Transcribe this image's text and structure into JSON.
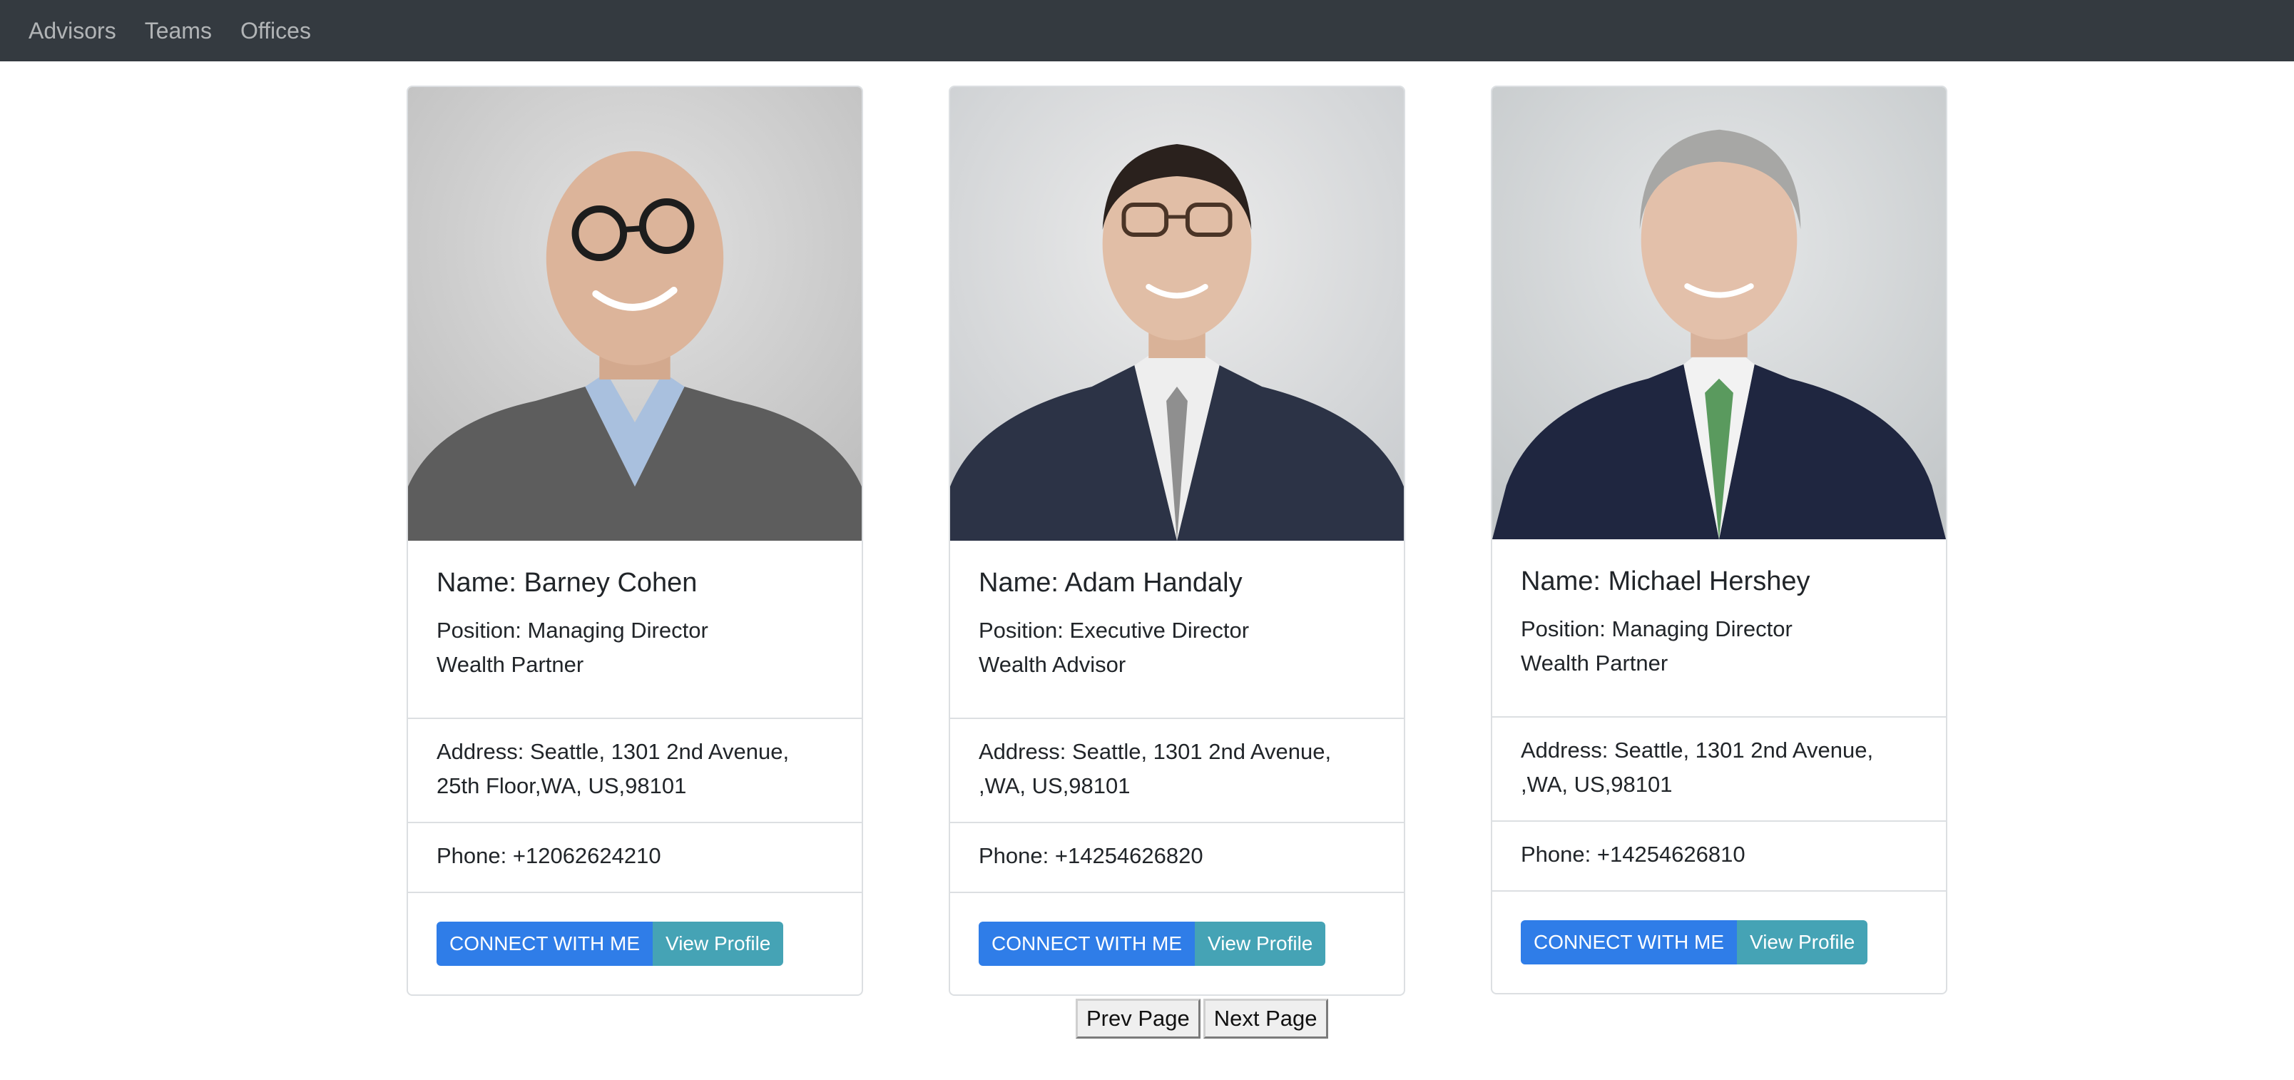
{
  "nav": {
    "items": [
      "Advisors",
      "Teams",
      "Offices"
    ]
  },
  "advisors": [
    {
      "name": "Name: Barney Cohen",
      "position_line1": "Position: Managing Director",
      "position_line2": "Wealth Partner",
      "address_line1": "Address: Seattle, 1301 2nd Avenue,",
      "address_line2": "25th Floor,WA, US,98101",
      "phone": "Phone: +12062624210",
      "connect_label": "CONNECT WITH ME",
      "profile_label": "View Profile"
    },
    {
      "name": "Name: Adam Handaly",
      "position_line1": "Position: Executive Director",
      "position_line2": "Wealth Advisor",
      "address_line1": "Address: Seattle, 1301 2nd Avenue,",
      "address_line2": ",WA, US,98101",
      "phone": "Phone: +14254626820",
      "connect_label": "CONNECT WITH ME",
      "profile_label": "View Profile"
    },
    {
      "name": "Name: Michael Hershey",
      "position_line1": "Position: Managing Director",
      "position_line2": "Wealth Partner",
      "address_line1": "Address: Seattle, 1301 2nd Avenue,",
      "address_line2": ",WA, US,98101",
      "phone": "Phone: +14254626810",
      "connect_label": "CONNECT WITH ME",
      "profile_label": "View Profile"
    }
  ],
  "pager": {
    "prev_label": "Prev Page",
    "next_label": "Next Page"
  },
  "colors": {
    "navbar": "#343a40",
    "primary_button": "#2f7de8",
    "info_button": "#45a3b5"
  }
}
